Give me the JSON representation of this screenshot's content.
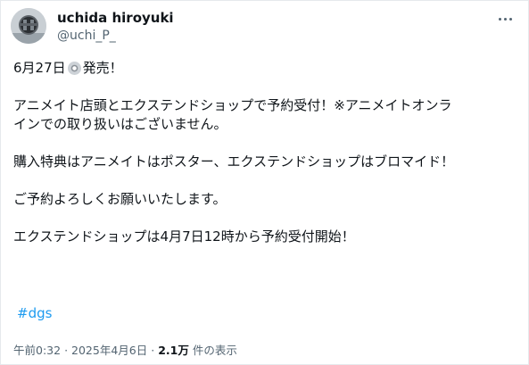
{
  "author": {
    "name": "uchida hiroyuki",
    "handle": "@uchi_P_"
  },
  "post": {
    "line1_prefix": "6月27日",
    "line1_suffix": "発売！",
    "line1_icon": "cd-disc-icon",
    "line2": "アニメイト店頭とエクステンドショップで予約受付！※アニメイトオンラ",
    "line3": "インでの取り扱いはございません。",
    "line4": "購入特典はアニメイトはポスター、エクステンドショップはブロマイド！",
    "line5": "ご予約よろしくお願いいたします。",
    "line6": "エクステンドショップは4月7日12時から予約受付開始！",
    "hashtag": "#dgs"
  },
  "meta": {
    "time": "午前0:32",
    "separator1": "·",
    "date": "2025年4月6日",
    "separator2": "·",
    "views_count": "2.1万",
    "views_label": "件の表示"
  },
  "icons": {
    "more": "more-options-icon",
    "avatar": "avatar-image"
  }
}
